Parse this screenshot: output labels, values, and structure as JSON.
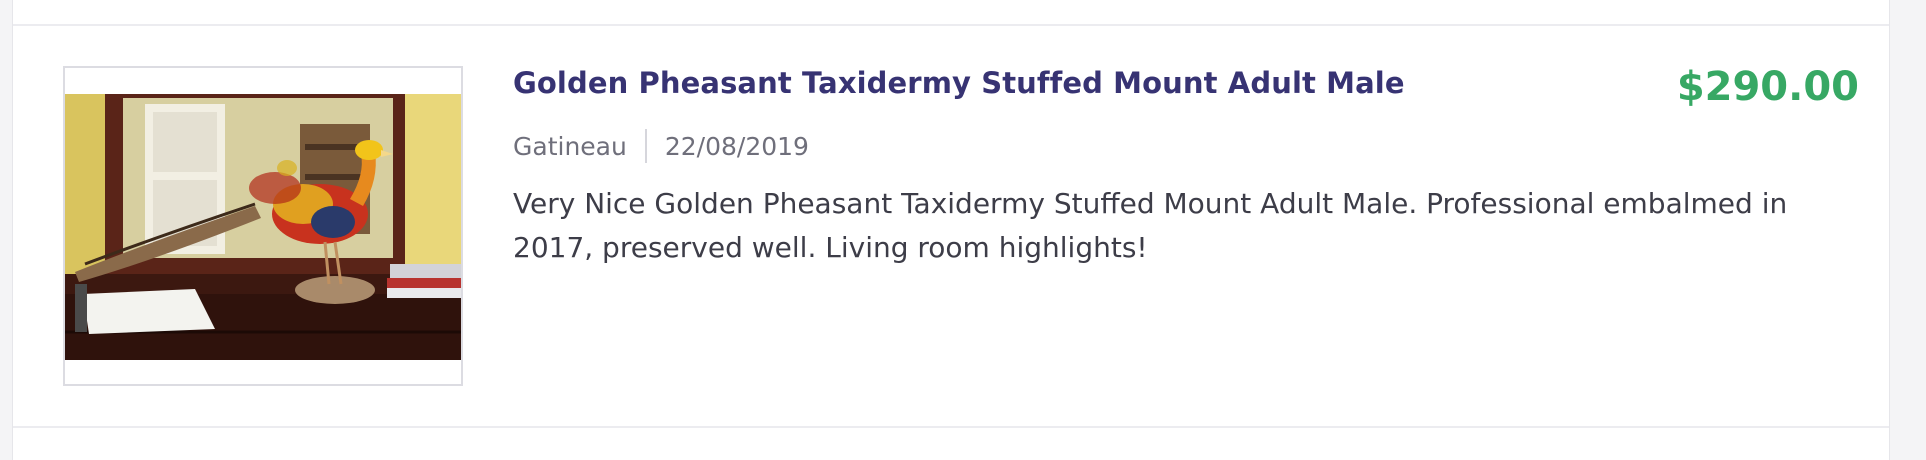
{
  "listing": {
    "title": "Golden Pheasant Taxidermy Stuffed Mount Adult Male",
    "price": "$290.00",
    "location": "Gatineau",
    "date": "22/08/2019",
    "description": "Very Nice Golden Pheasant Taxidermy Stuffed Mount Adult Male. Professional embalmed in 2017, preserved well. Living room highlights!",
    "favorite_icon": "heart-icon"
  },
  "colors": {
    "title": "#373373",
    "price": "#37a864",
    "meta": "#6f6f7b",
    "text": "#3d3d48",
    "border": "#dcdce2"
  }
}
